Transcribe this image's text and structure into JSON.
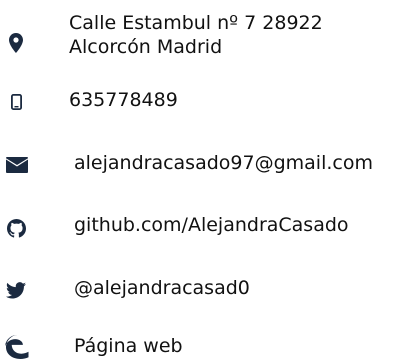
{
  "contact": {
    "address": {
      "icon": "map-marker-icon",
      "line1": "Calle Estambul nº 7 28922",
      "line2": "Alcorcón Madrid"
    },
    "phone": {
      "icon": "mobile-phone-icon",
      "text": "635778489"
    },
    "email": {
      "icon": "envelope-icon",
      "text": "alejandracasado97@gmail.com"
    },
    "github": {
      "icon": "github-icon",
      "text": "github.com/AlejandraCasado"
    },
    "twitter": {
      "icon": "twitter-icon",
      "text": "@alejandracasad0"
    },
    "website": {
      "icon": "edge-browser-icon",
      "text": "Página web"
    }
  },
  "colors": {
    "icon": "#1b2a40",
    "text": "#111111",
    "background": "#ffffff"
  }
}
